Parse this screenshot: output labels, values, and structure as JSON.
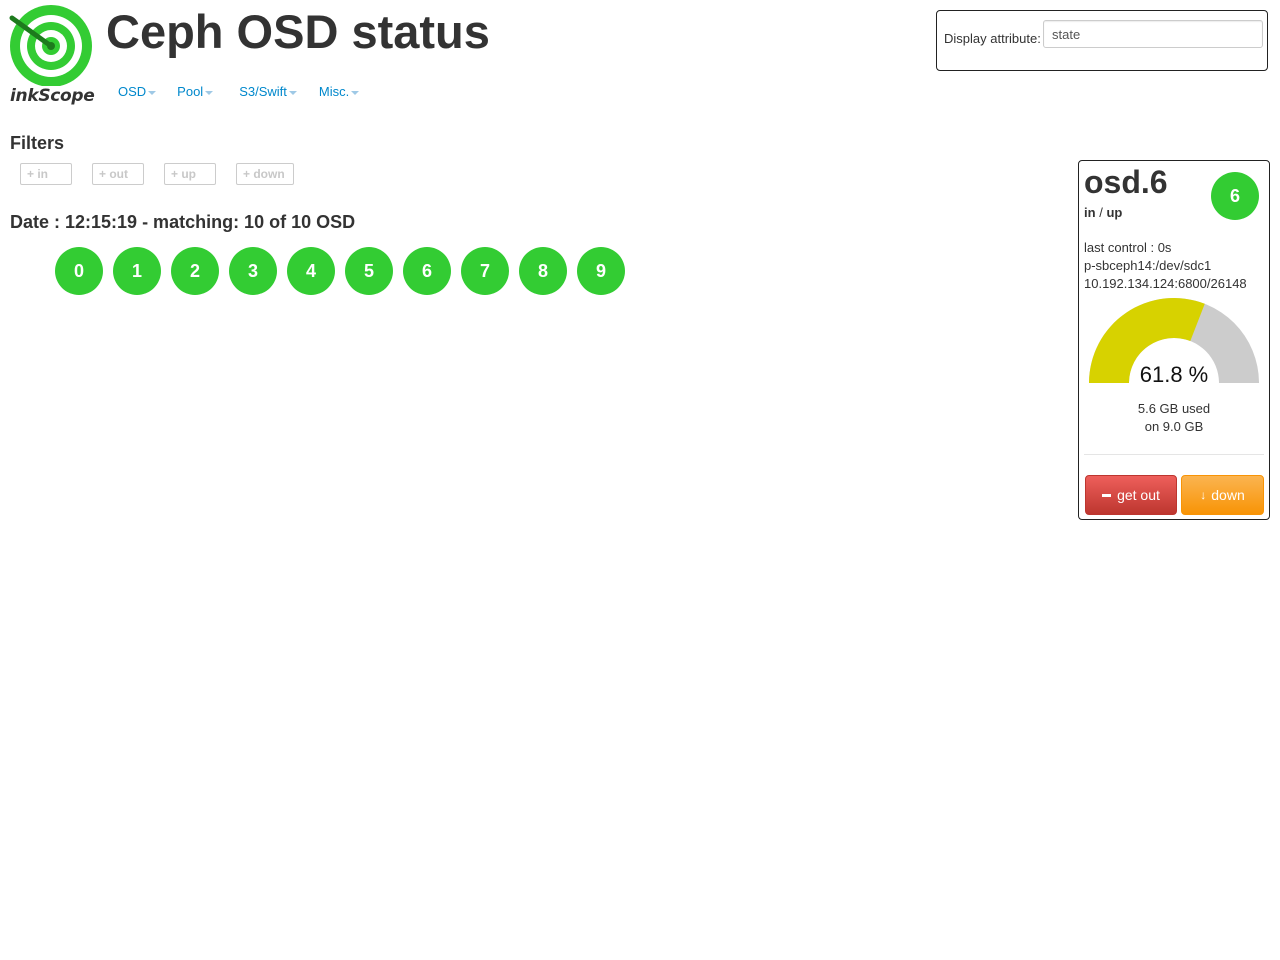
{
  "logo": {
    "text": "inkScope",
    "icon": "target-logo-icon",
    "color": "#33cc33"
  },
  "header": {
    "title": "Ceph OSD status"
  },
  "nav": {
    "items": [
      {
        "label": "OSD"
      },
      {
        "label": "Pool"
      },
      {
        "label": "S3/Swift"
      },
      {
        "label": "Misc."
      }
    ]
  },
  "display_attribute": {
    "label": "Display attribute:",
    "value": "state"
  },
  "filters": {
    "title": "Filters",
    "buttons": [
      {
        "label": "+ in"
      },
      {
        "label": "+ out"
      },
      {
        "label": "+ up"
      },
      {
        "label": "+ down"
      }
    ]
  },
  "status": {
    "line": "Date : 12:15:19 - matching: 10 of 10 OSD"
  },
  "osds": [
    "0",
    "1",
    "2",
    "3",
    "4",
    "5",
    "6",
    "7",
    "8",
    "9"
  ],
  "osd_color": "#33cc33",
  "detail": {
    "name": "osd.6",
    "state_in": "in",
    "state_sep": "/",
    "state_up": "up",
    "badge": "6",
    "last_control": "last control : 0s",
    "device": "p-sbceph14:/dev/sdc1",
    "address": "10.192.134.124:6800/26148",
    "usage_percent": 61.8,
    "usage_label": "61.8 %",
    "used_line": "5.6 GB used",
    "total_line": "on 9.0 GB",
    "gauge_colors": {
      "used": "#d7d200",
      "free": "#cccccc"
    },
    "buttons": {
      "get_out": "get out",
      "down": "down"
    }
  }
}
